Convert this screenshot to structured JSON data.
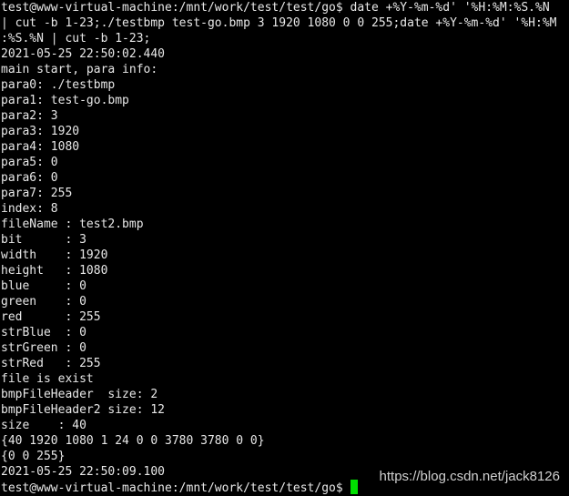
{
  "terminal": {
    "lines": [
      "test@www-virtual-machine:/mnt/work/test/test/go$ date +%Y-%m-%d' '%H:%M:%S.%N",
      "| cut -b 1-23;./testbmp test-go.bmp 3 1920 1080 0 0 255;date +%Y-%m-%d' '%H:%M",
      ":%S.%N | cut -b 1-23;",
      "2021-05-25 22:50:02.440",
      "main start, para info:",
      "para0: ./testbmp",
      "para1: test-go.bmp",
      "para2: 3",
      "para3: 1920",
      "para4: 1080",
      "para5: 0",
      "para6: 0",
      "para7: 255",
      "index: 8",
      "fileName : test2.bmp",
      "bit      : 3",
      "width    : 1920",
      "height   : 1080",
      "blue     : 0",
      "green    : 0",
      "red      : 255",
      "strBlue  : 0",
      "strGreen : 0",
      "strRed   : 255",
      "file is exist",
      "bmpFileHeader  size: 2",
      "bmpFileHeader2 size: 12",
      "size    : 40",
      "{40 1920 1080 1 24 0 0 3780 3780 0 0}",
      "{0 0 255}",
      "2021-05-25 22:50:09.100"
    ],
    "prompt": "test@www-virtual-machine:/mnt/work/test/test/go$ ",
    "cursor_color": "#00e000"
  },
  "watermark": "https://blog.csdn.net/jack8126"
}
